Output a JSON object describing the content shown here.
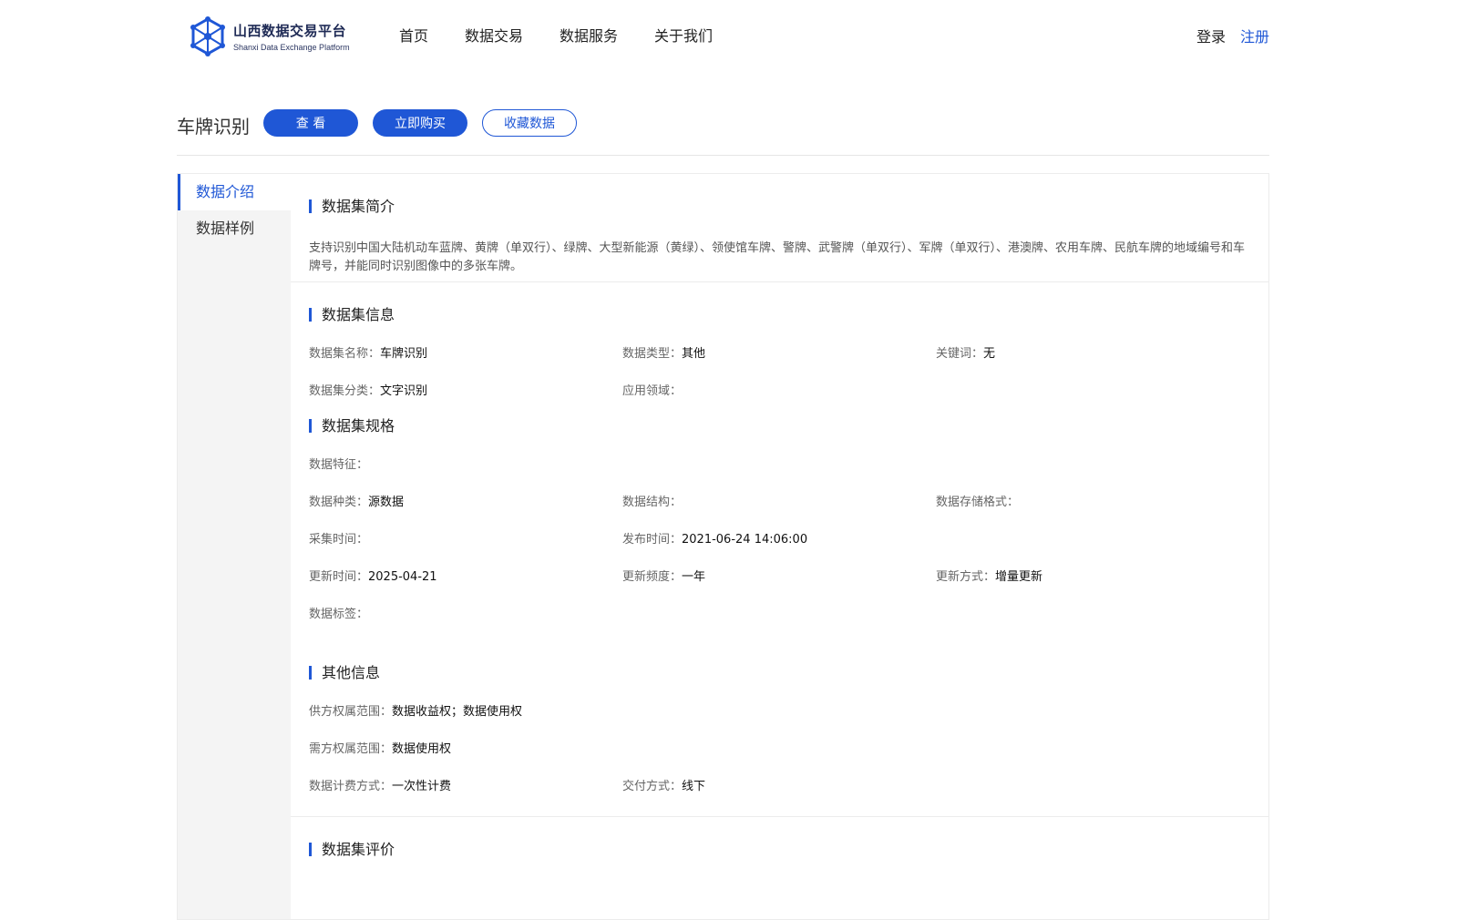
{
  "header": {
    "logo_title": "山西数据交易平台",
    "logo_subtitle": "Shanxi Data Exchange Platform",
    "nav": [
      "首页",
      "数据交易",
      "数据服务",
      "关于我们"
    ],
    "login": "登录",
    "register": "注册"
  },
  "titlebar": {
    "title": "车牌识别",
    "view": "查 看",
    "buy": "立即购买",
    "favorite": "收藏数据"
  },
  "sidebar": {
    "items": [
      "数据介绍",
      "数据样例"
    ]
  },
  "intro": {
    "heading": "数据集简介",
    "text": "支持识别中国大陆机动车蓝牌、黄牌（单双行）、绿牌、大型新能源（黄绿）、领使馆车牌、警牌、武警牌（单双行）、军牌（单双行）、港澳牌、农用车牌、民航车牌的地域编号和车牌号，并能同时识别图像中的多张车牌。"
  },
  "info": {
    "heading": "数据集信息",
    "name_label": "数据集名称：",
    "name_value": "车牌识别",
    "type_label": "数据类型：",
    "type_value": "其他",
    "keyword_label": "关键词：",
    "keyword_value": "无",
    "category_label": "数据集分类：",
    "category_value": "文字识别",
    "domain_label": "应用领域：",
    "domain_value": ""
  },
  "spec": {
    "heading": "数据集规格",
    "feature_label": "数据特征：",
    "feature_value": "",
    "kind_label": "数据种类：",
    "kind_value": "源数据",
    "structure_label": "数据结构：",
    "structure_value": "",
    "storage_label": "数据存储格式：",
    "storage_value": "",
    "collect_label": "采集时间：",
    "collect_value": "",
    "publish_label": "发布时间：",
    "publish_value": "2021-06-24 14:06:00",
    "update_label": "更新时间：",
    "update_value": "2025-04-21",
    "freq_label": "更新频度：",
    "freq_value": "一年",
    "method_label": "更新方式：",
    "method_value": "增量更新",
    "tags_label": "数据标签：",
    "tags_value": ""
  },
  "other": {
    "heading": "其他信息",
    "supply_label": "供方权属范围：",
    "supply_value": "数据收益权；数据使用权",
    "demand_label": "需方权属范围：",
    "demand_value": "数据使用权",
    "billing_label": "数据计费方式：",
    "billing_value": "一次性计费",
    "delivery_label": "交付方式：",
    "delivery_value": "线下"
  },
  "review": {
    "heading": "数据集评价"
  },
  "colors": {
    "accent": "#1f57d6",
    "sidebar_bg": "#f4f4f4"
  },
  "icons": {
    "logo": "hexagon-network-logo-icon"
  }
}
